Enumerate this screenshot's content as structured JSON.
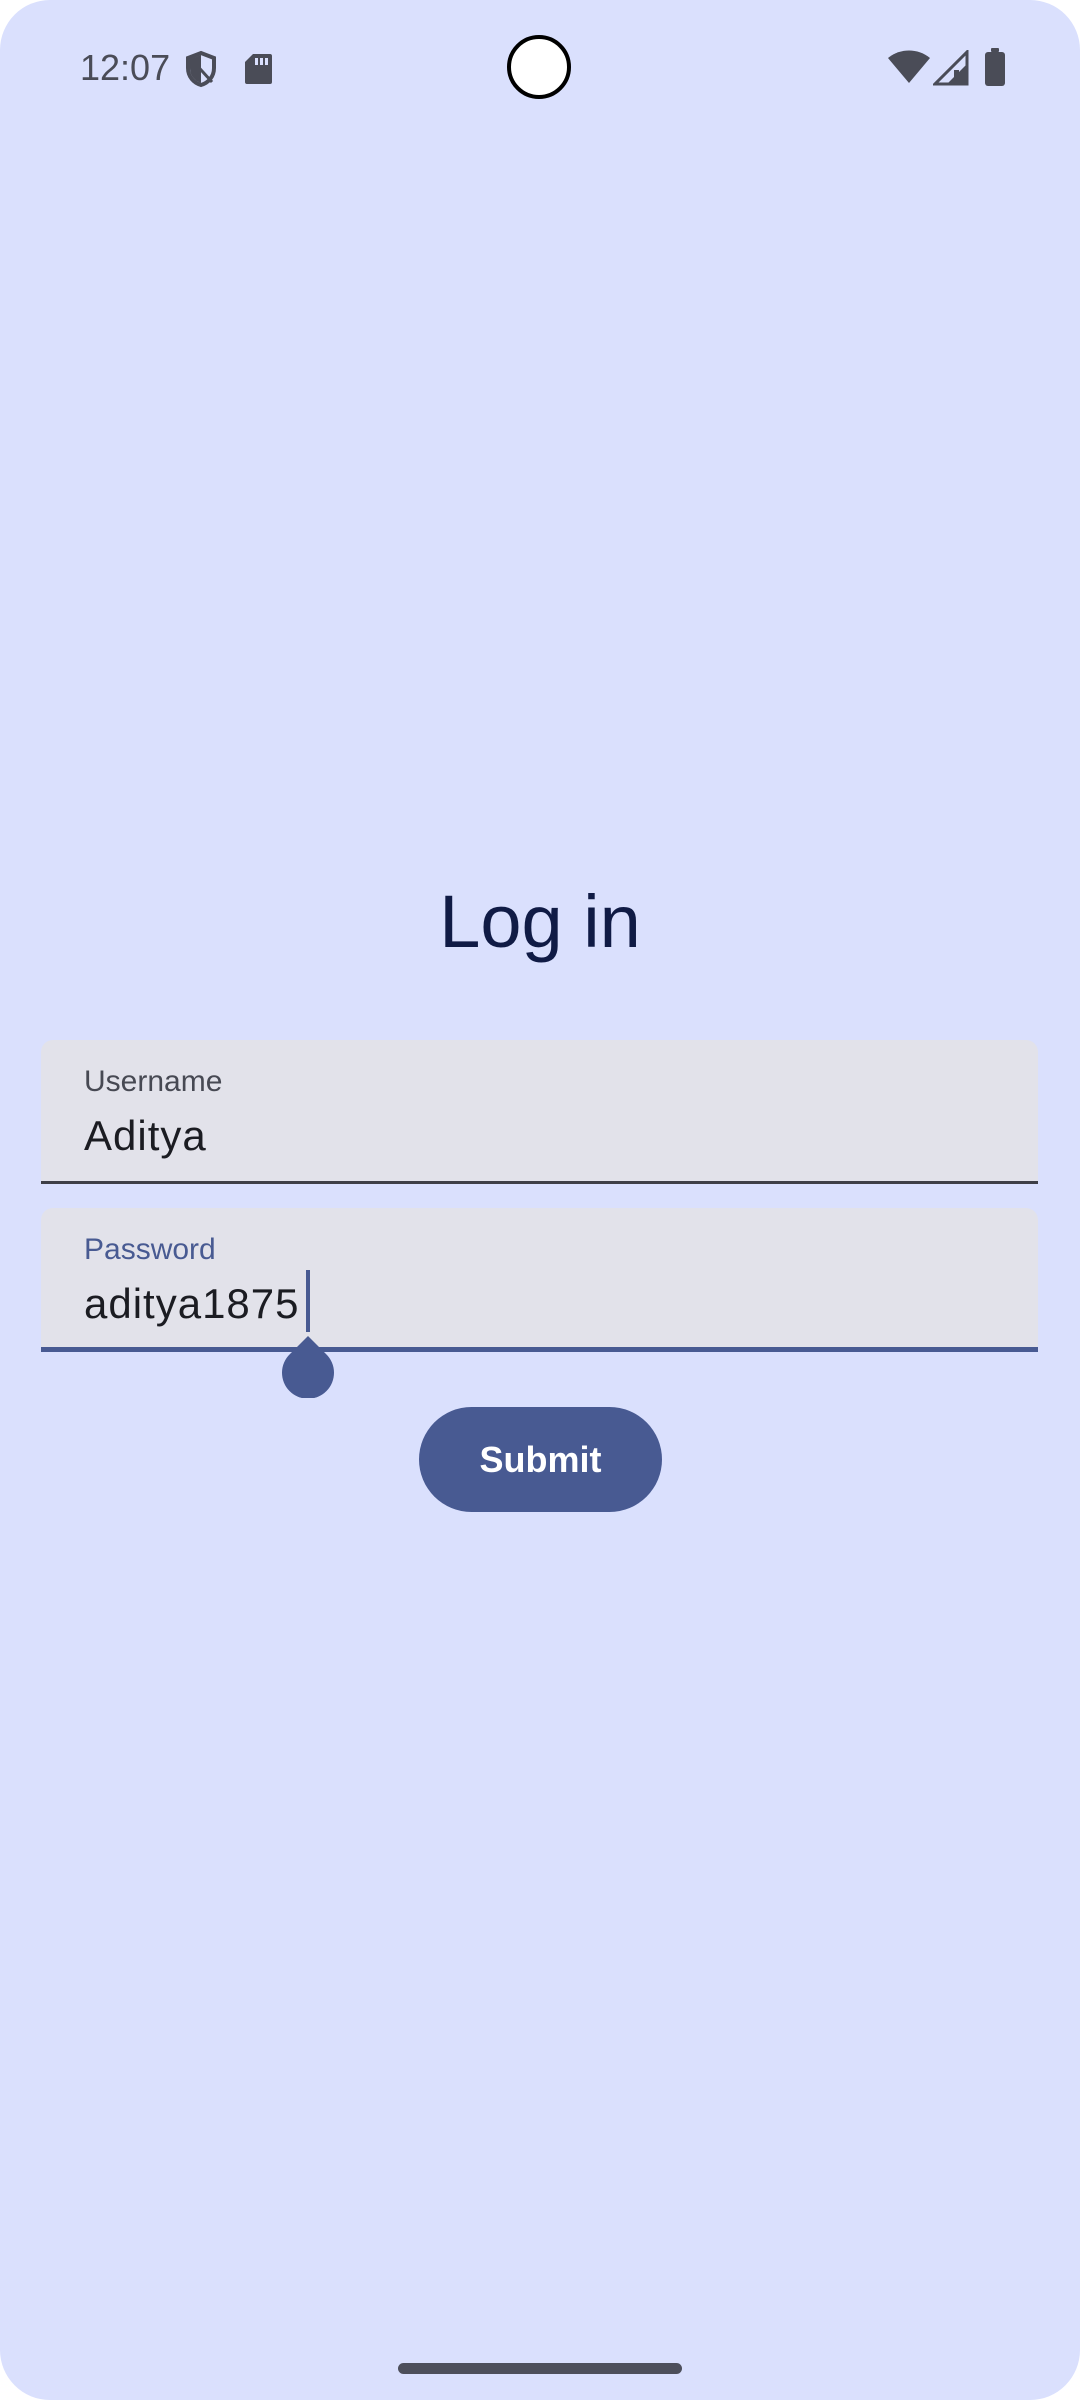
{
  "status_bar": {
    "time": "12:07",
    "left_icons": [
      "shield-icon",
      "sd-card-icon"
    ],
    "right_icons": [
      "wifi-icon",
      "cell-signal-icon",
      "battery-icon"
    ]
  },
  "login": {
    "title": "Log in",
    "username": {
      "label": "Username",
      "value": "Aditya"
    },
    "password": {
      "label": "Password",
      "value": "aditya1875"
    },
    "submit_label": "Submit"
  },
  "colors": {
    "background": "#dae0fd",
    "primary": "#485a92",
    "title": "#101b45",
    "field_fill": "#e2e2ea"
  }
}
